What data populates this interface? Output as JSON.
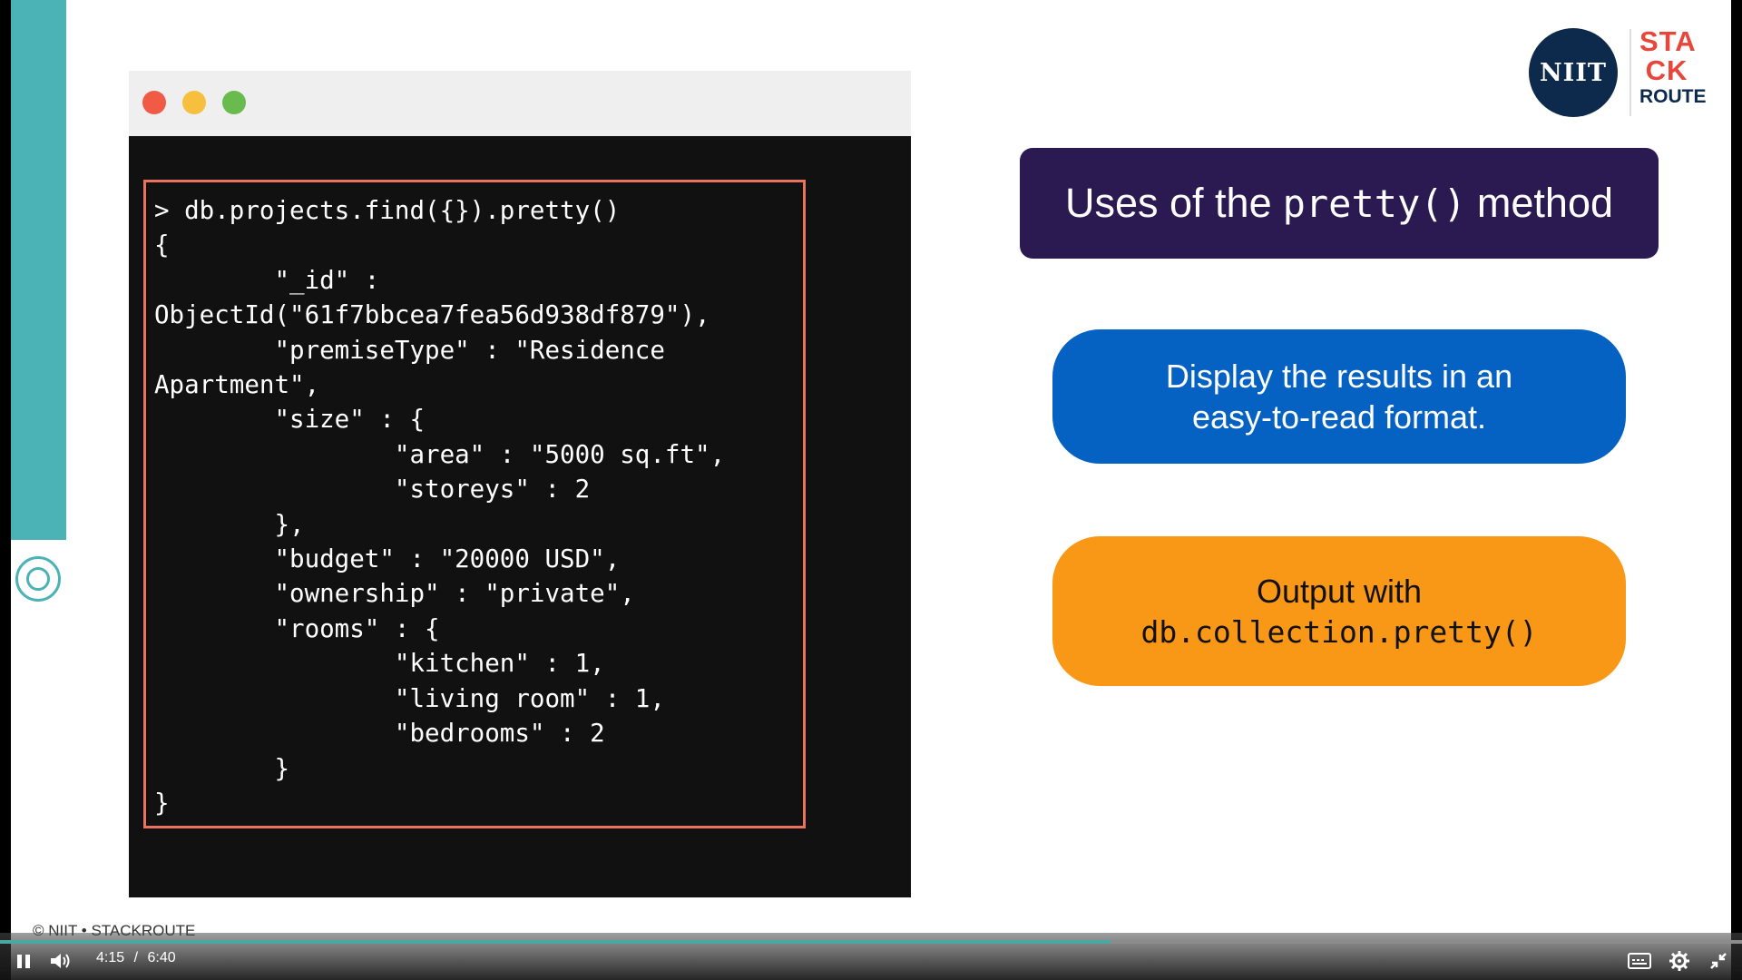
{
  "slide": {
    "title_prefix": "Uses of the",
    "title_code": "pretty()",
    "title_suffix": "method",
    "point1_line1": "Display the results in an",
    "point1_line2": "easy-to-read format.",
    "point2_line1": "Output with",
    "point2_code": "db.collection.pretty()",
    "logo_niit": "NIIT",
    "logo_stack_1": "STA",
    "logo_stack_2": "CK",
    "logo_stack_3": "ROUTE",
    "copyright": "© NIIT • STACKROUTE",
    "code_lines": [
      "> db.projects.find({}).pretty()",
      "{",
      "        \"_id\" :",
      "ObjectId(\"61f7bbcea7fea56d938df879\"),",
      "        \"premiseType\" : \"Residence",
      "Apartment\",",
      "        \"size\" : {",
      "                \"area\" : \"5000 sq.ft\",",
      "                \"storeys\" : 2",
      "        },",
      "        \"budget\" : \"20000 USD\",",
      "        \"ownership\" : \"private\",",
      "        \"rooms\" : {",
      "                \"kitchen\" : 1,",
      "                \"living room\" : 1,",
      "                \"bedrooms\" : 2",
      "        }",
      "}"
    ]
  },
  "player": {
    "current_time": "4:15",
    "separator": "/",
    "duration": "6:40",
    "progress_fraction": 0.6375,
    "icons": [
      "pause-icon",
      "volume-icon",
      "captions-icon",
      "settings-icon",
      "exit-fullscreen-icon"
    ]
  },
  "colors": {
    "title_bg": "#2b1a52",
    "blue_pill": "#0561c2",
    "orange_pill": "#f99716",
    "code_border": "#e9735c",
    "rail": "#4bb3b5",
    "progress": "#49a8a4"
  }
}
